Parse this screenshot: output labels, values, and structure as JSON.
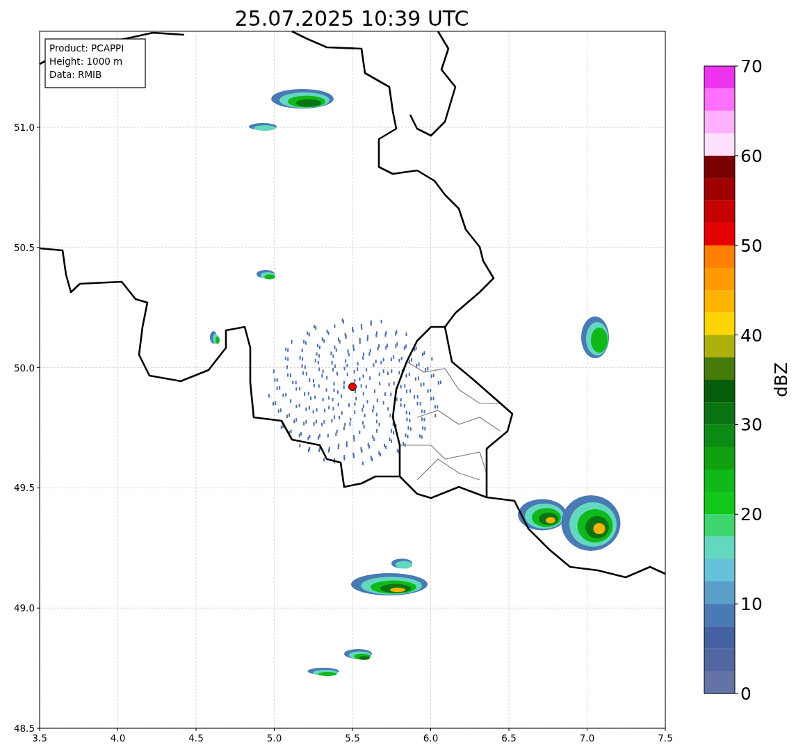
{
  "title": "25.07.2025 10:39 UTC",
  "info_box": [
    "Product: PCAPPI",
    "Height: 1000 m",
    "Data: RMIB"
  ],
  "x_axis": {
    "ticks": [
      "3.5",
      "4.0",
      "4.5",
      "5.0",
      "5.5",
      "6.0",
      "6.5",
      "7.0",
      "7.5"
    ]
  },
  "y_axis": {
    "ticks": [
      "51.0",
      "50.5",
      "50.0",
      "49.5",
      "49.0",
      "48.5"
    ]
  },
  "colorbar": {
    "label": "dBZ",
    "ticks": [
      "70",
      "60",
      "50",
      "40",
      "30",
      "20",
      "10",
      "0"
    ],
    "segments": [
      {
        "color": "#ee33ee"
      },
      {
        "color": "#ff70ff"
      },
      {
        "color": "#ffb0ff"
      },
      {
        "color": "#ffe0ff"
      },
      {
        "color": "#7a0000"
      },
      {
        "color": "#a10000"
      },
      {
        "color": "#c40000"
      },
      {
        "color": "#e50000"
      },
      {
        "color": "#ff7f00"
      },
      {
        "color": "#ff9a00"
      },
      {
        "color": "#fdb400"
      },
      {
        "color": "#fdd500"
      },
      {
        "color": "#adb00a"
      },
      {
        "color": "#467a0b"
      },
      {
        "color": "#075c0c"
      },
      {
        "color": "#0a7412"
      },
      {
        "color": "#0b8a14"
      },
      {
        "color": "#10a010"
      },
      {
        "color": "#10b81a"
      },
      {
        "color": "#10c81a"
      },
      {
        "color": "#3dd56e"
      },
      {
        "color": "#63d8c0"
      },
      {
        "color": "#66c1db"
      },
      {
        "color": "#5a9fc8"
      },
      {
        "color": "#4a7ab4"
      },
      {
        "color": "#4560a3"
      },
      {
        "color": "#5267a0"
      },
      {
        "color": "#6473a6"
      }
    ]
  }
}
